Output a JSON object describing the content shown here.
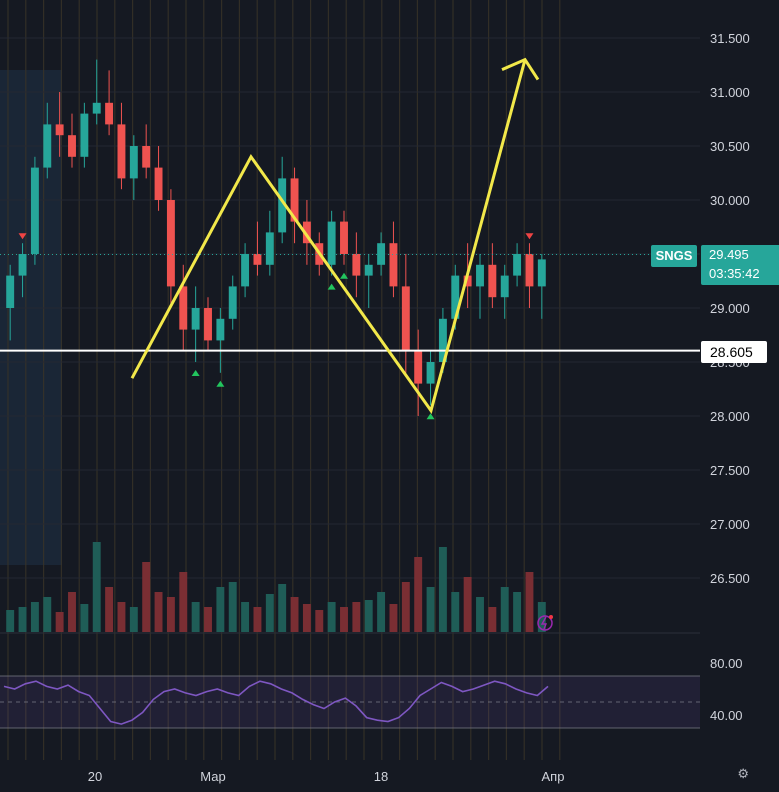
{
  "symbol": "SNGS",
  "last_price": "29.495",
  "countdown": "03:35:42",
  "level_price": "28.605",
  "settings_icon": "gear-icon",
  "chart_data": [
    {
      "type": "candlestick",
      "title": "",
      "price_ticks": [
        26.5,
        27.0,
        27.5,
        28.0,
        28.5,
        29.0,
        29.5,
        30.0,
        30.5,
        31.0,
        31.5
      ],
      "price_tick_labels": [
        "26.500",
        "27.000",
        "27.500",
        "28.000",
        "28.500",
        "29.000",
        "29.500",
        "30.000",
        "30.500",
        "31.000",
        "31.500"
      ],
      "ylim": [
        26.3,
        31.7
      ],
      "time_labels": [
        "20",
        "Мар",
        "18",
        "Апр"
      ],
      "horizontal_level": 28.605,
      "pattern_path_prices": [
        28.35,
        30.4,
        28.05,
        31.3
      ],
      "candles": [
        [
          29.0,
          29.4,
          28.7,
          29.3
        ],
        [
          29.3,
          29.6,
          29.1,
          29.5
        ],
        [
          29.5,
          30.4,
          29.4,
          30.3
        ],
        [
          30.3,
          30.9,
          30.2,
          30.7
        ],
        [
          30.7,
          31.0,
          30.4,
          30.6
        ],
        [
          30.6,
          30.8,
          30.3,
          30.4
        ],
        [
          30.4,
          30.9,
          30.3,
          30.8
        ],
        [
          30.8,
          31.3,
          30.7,
          30.9
        ],
        [
          30.9,
          31.2,
          30.6,
          30.7
        ],
        [
          30.7,
          30.9,
          30.1,
          30.2
        ],
        [
          30.2,
          30.6,
          30.0,
          30.5
        ],
        [
          30.5,
          30.7,
          30.2,
          30.3
        ],
        [
          30.3,
          30.5,
          29.9,
          30.0
        ],
        [
          30.0,
          30.1,
          29.0,
          29.2
        ],
        [
          29.2,
          29.4,
          28.6,
          28.8
        ],
        [
          28.8,
          29.2,
          28.5,
          29.0
        ],
        [
          29.0,
          29.1,
          28.6,
          28.7
        ],
        [
          28.7,
          29.0,
          28.4,
          28.9
        ],
        [
          28.9,
          29.3,
          28.8,
          29.2
        ],
        [
          29.2,
          29.6,
          29.1,
          29.5
        ],
        [
          29.5,
          29.8,
          29.3,
          29.4
        ],
        [
          29.4,
          29.9,
          29.3,
          29.7
        ],
        [
          29.7,
          30.4,
          29.6,
          30.2
        ],
        [
          30.2,
          30.3,
          29.6,
          29.8
        ],
        [
          29.8,
          30.0,
          29.4,
          29.6
        ],
        [
          29.6,
          29.7,
          29.3,
          29.4
        ],
        [
          29.4,
          29.9,
          29.3,
          29.8
        ],
        [
          29.8,
          29.9,
          29.4,
          29.5
        ],
        [
          29.5,
          29.7,
          29.1,
          29.3
        ],
        [
          29.3,
          29.5,
          29.0,
          29.4
        ],
        [
          29.4,
          29.7,
          29.3,
          29.6
        ],
        [
          29.6,
          29.8,
          29.1,
          29.2
        ],
        [
          29.2,
          29.5,
          28.4,
          28.6
        ],
        [
          28.6,
          28.8,
          28.0,
          28.3
        ],
        [
          28.3,
          28.6,
          28.1,
          28.5
        ],
        [
          28.5,
          29.0,
          28.4,
          28.9
        ],
        [
          28.9,
          29.4,
          28.8,
          29.3
        ],
        [
          29.3,
          29.6,
          29.0,
          29.2
        ],
        [
          29.2,
          29.5,
          28.9,
          29.4
        ],
        [
          29.4,
          29.6,
          29.0,
          29.1
        ],
        [
          29.1,
          29.4,
          28.9,
          29.3
        ],
        [
          29.3,
          29.6,
          29.2,
          29.5
        ],
        [
          29.5,
          29.6,
          29.0,
          29.2
        ],
        [
          29.2,
          29.5,
          28.9,
          29.45
        ]
      ],
      "markers": [
        {
          "type": "sell",
          "index": 1
        },
        {
          "type": "buy",
          "index": 15
        },
        {
          "type": "buy",
          "index": 17
        },
        {
          "type": "buy",
          "index": 26
        },
        {
          "type": "buy",
          "index": 27
        },
        {
          "type": "buy",
          "index": 34
        },
        {
          "type": "sell",
          "index": 42
        }
      ],
      "volume": [
        22,
        25,
        30,
        35,
        20,
        40,
        28,
        90,
        45,
        30,
        25,
        70,
        40,
        35,
        60,
        30,
        25,
        45,
        50,
        30,
        25,
        38,
        48,
        35,
        28,
        22,
        30,
        25,
        30,
        32,
        40,
        28,
        50,
        75,
        45,
        85,
        40,
        55,
        35,
        25,
        45,
        40,
        60,
        30
      ],
      "rsi": {
        "ticks": [
          40.0,
          80.0
        ],
        "tick_labels": [
          "40.00",
          "80.00"
        ],
        "bands": [
          30,
          50,
          70
        ],
        "values": [
          62,
          60,
          64,
          66,
          62,
          60,
          63,
          58,
          55,
          45,
          35,
          33,
          36,
          42,
          52,
          58,
          60,
          57,
          55,
          58,
          60,
          57,
          55,
          62,
          66,
          64,
          60,
          57,
          52,
          48,
          45,
          50,
          53,
          47,
          38,
          36,
          35,
          38,
          45,
          55,
          60,
          65,
          62,
          58,
          60,
          63,
          66,
          64,
          60,
          57,
          55,
          62
        ]
      }
    }
  ]
}
